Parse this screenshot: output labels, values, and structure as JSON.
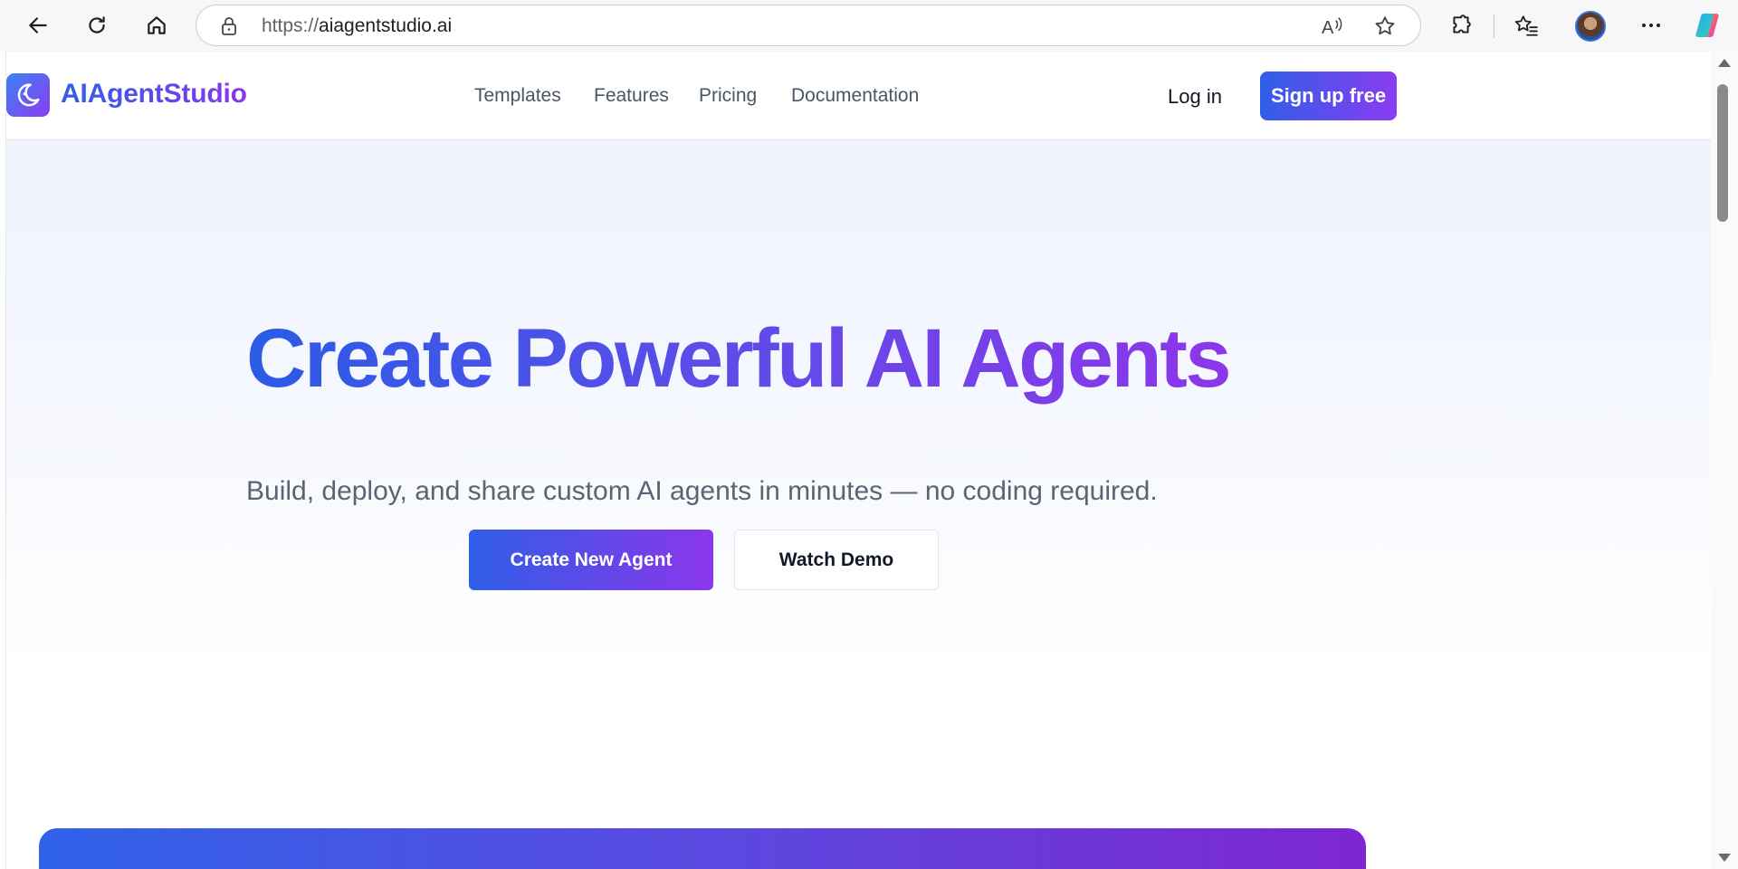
{
  "browser": {
    "url_prefix": "https://",
    "url_host": "aiagentstudio.ai",
    "icons": [
      "back-icon",
      "refresh-icon",
      "home-icon",
      "lock-icon",
      "read-aloud-icon",
      "favorite-star-icon",
      "extensions-icon",
      "favorites-icon",
      "profile-avatar",
      "more-icon",
      "copilot-icon"
    ]
  },
  "header": {
    "brand": "AIAgentStudio",
    "nav": [
      {
        "label": "Templates"
      },
      {
        "label": "Features"
      },
      {
        "label": "Pricing"
      },
      {
        "label": "Documentation"
      }
    ],
    "login": "Log in",
    "signup": "Sign up free"
  },
  "hero": {
    "title": "Create Powerful AI Agents",
    "subtitle": "Build, deploy, and share custom AI agents in minutes — no coding required.",
    "primary_cta": "Create New Agent",
    "secondary_cta": "Watch Demo"
  },
  "colors": {
    "accent_blue": "#2f5ee8",
    "accent_purple": "#8b3cf0",
    "hero_bg": "#eef3fd"
  }
}
